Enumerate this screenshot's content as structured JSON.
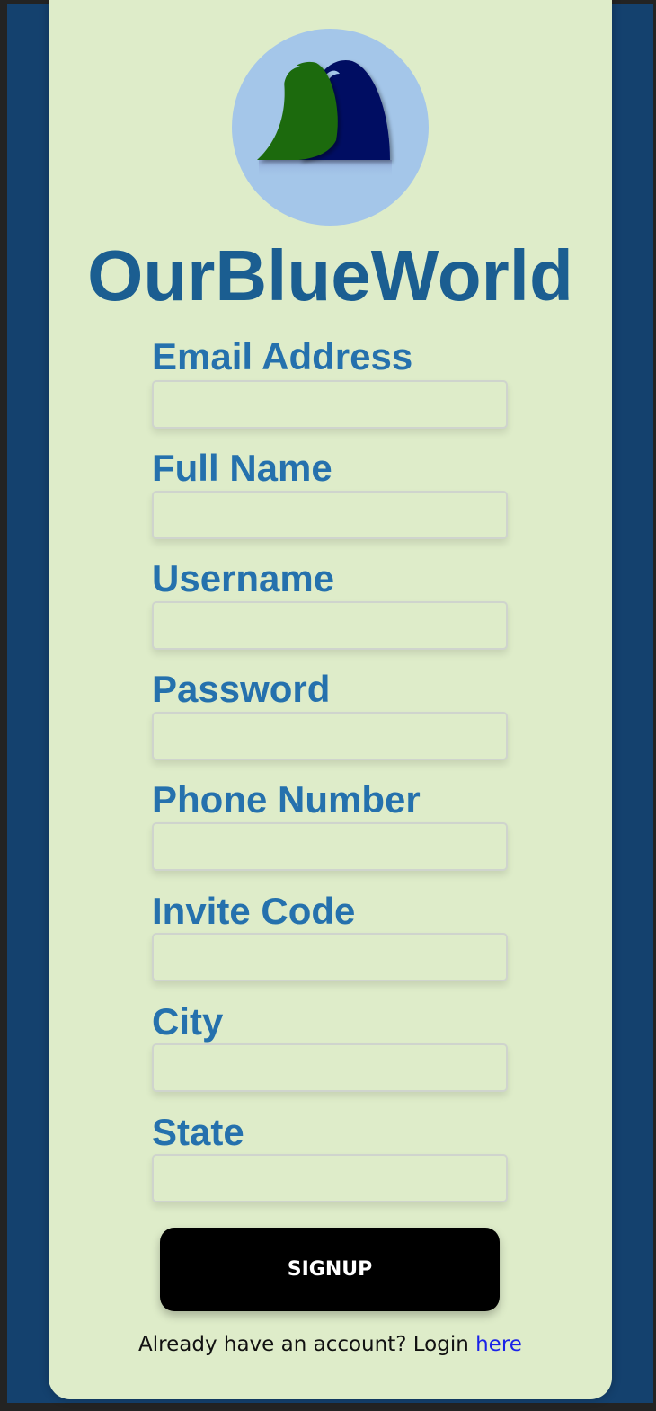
{
  "brand": {
    "title": "OurBlueWorld",
    "logo_icon": "wave-fins-logo-icon",
    "colors": {
      "background": "#14416e",
      "card": "#deecc9",
      "title": "#1b5e91",
      "label": "#2571ad",
      "logo_circle": "#a4c6e9",
      "logo_green": "#1f6b0a",
      "logo_navy": "#020a62"
    }
  },
  "form": {
    "fields": [
      {
        "label": "Email Address",
        "value": "",
        "placeholder": ""
      },
      {
        "label": "Full Name",
        "value": "",
        "placeholder": ""
      },
      {
        "label": "Username",
        "value": "",
        "placeholder": ""
      },
      {
        "label": "Password",
        "value": "",
        "placeholder": ""
      },
      {
        "label": "Phone Number",
        "value": "",
        "placeholder": ""
      },
      {
        "label": "Invite Code",
        "value": "",
        "placeholder": ""
      },
      {
        "label": "City",
        "value": "",
        "placeholder": ""
      },
      {
        "label": "State",
        "value": "",
        "placeholder": ""
      }
    ],
    "submit_label": "SIGNUP"
  },
  "footer": {
    "prompt": "Already have an account? Login ",
    "link_label": "here"
  }
}
